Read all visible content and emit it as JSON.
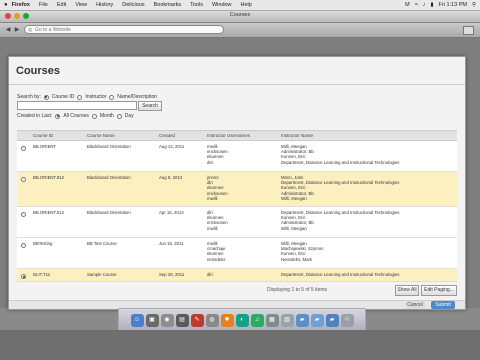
{
  "menubar": {
    "apple": "",
    "items": [
      "Firefox",
      "File",
      "Edit",
      "View",
      "History",
      "Delicious",
      "Bookmarks",
      "Tools",
      "Window",
      "Help"
    ],
    "right_status": "M",
    "clock": "Fri 1:13 PM"
  },
  "window": {
    "title": "Courses"
  },
  "toolbar": {
    "url_placeholder": "Go to a Website"
  },
  "modal": {
    "title": "Courses",
    "search": {
      "label": "Search by:",
      "options": [
        "Course ID",
        "Instructor",
        "Name/Description"
      ],
      "selected": 0,
      "button": "Search"
    },
    "created": {
      "label": "Created in Last:",
      "options": [
        "All Courses",
        "Month",
        "Day"
      ],
      "selected": 0
    },
    "columns": [
      "Course ID",
      "Course Name",
      "Created",
      "Instructor Usernames",
      "Instructor Name"
    ],
    "rows": [
      {
        "id": "BB.ORIENT",
        "name": "Blackboard Orientation",
        "created": "Aug 13, 2011",
        "usernames": [
          "mwilli",
          "ericksonen",
          "ekunnen",
          "dtri"
        ],
        "names": [
          "Willi, Meegan",
          "Administrator, Bb",
          "Kunnen, Eric",
          "Department, Distance Learning and Instructional Technologies"
        ],
        "style": "white",
        "selected": false
      },
      {
        "id": "BB.ORIENT.812",
        "name": "Blackboard Orientation",
        "created": "Aug 9, 2013",
        "usernames": [
          "jmnmr",
          "dlri",
          "ekunnen",
          "ericksonen",
          "mwilli"
        ],
        "names": [
          "Mmm, John",
          "Department, Distance Learning and Instructional Technologies",
          "Kunnen, Eric",
          "Administrator, Bb",
          "Willi, Meegan"
        ],
        "style": "alt",
        "selected": false
      },
      {
        "id": "BB.ORIENT.512",
        "name": "Blackboard Orientation",
        "created": "Apr 15, 2013",
        "usernames": [
          "dlri",
          "ekunnen",
          "ericksonen",
          "mwilli"
        ],
        "names": [
          "Department, Distance Learning and Instructional Technologies",
          "Kunnen, Eric",
          "Administrator, Bb",
          "Willi, Meegan"
        ],
        "style": "white",
        "selected": false
      },
      {
        "id": "BBTesting",
        "name": "BB Test Course",
        "created": "Jun 15, 2011",
        "usernames": [
          "mwilli",
          "cmachaje",
          "ekunnen",
          "neisrdeks"
        ],
        "names": [
          "Willi, Meegan",
          "Machajewski, Szymon",
          "Kunnen, Eric",
          "Neisrdeks, Mark"
        ],
        "style": "white",
        "selected": false
      },
      {
        "id": "DLIT.T11",
        "name": "Sample Course",
        "created": "Sep 28, 2011",
        "usernames": [
          "dlri"
        ],
        "names": [
          "Department, Distance Learning and Instructional Technologies"
        ],
        "style": "alt",
        "selected": true
      }
    ],
    "paging_text": "Displaying 1 to 5 of 5 items",
    "show_all": "Show All",
    "edit_paging": "Edit Paging...",
    "cancel": "Cancel",
    "submit": "Submit"
  },
  "dock_icons": [
    "finder-icon",
    "app-icon",
    "app-icon",
    "app-icon",
    "pdf-icon",
    "app-icon",
    "firefox-icon",
    "app-icon",
    "spotify-icon",
    "app-icon",
    "app-icon",
    "folder-icon",
    "folder-icon",
    "folder-icon",
    "trash-icon"
  ]
}
